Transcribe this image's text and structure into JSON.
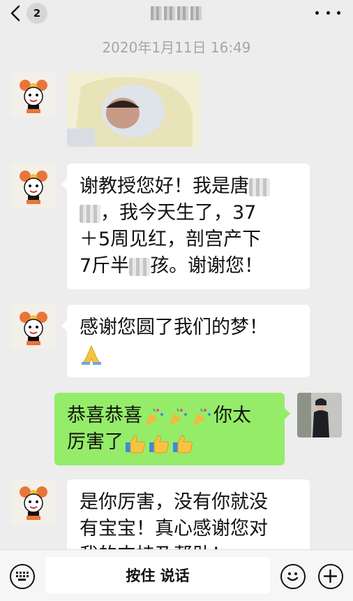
{
  "header": {
    "back_badge": "2",
    "title_redacted": true
  },
  "chat": {
    "timestamp": "2020年1月11日 16:49",
    "messages": [
      {
        "side": "left",
        "type": "image",
        "image_desc_icon": "newborn-photo"
      },
      {
        "side": "left",
        "type": "text",
        "lines": [
          "谢教授您好！我是唐",
          "，我今天生了，37",
          "＋5周见红，剖宫产下",
          "7斤半",
          "孩。谢谢您！"
        ]
      },
      {
        "side": "left",
        "type": "text",
        "lines": [
          "感谢您圆了我们的梦！"
        ],
        "emoji": "folded-hands-icon"
      },
      {
        "side": "right",
        "type": "text",
        "segments": [
          "恭喜恭喜",
          "你太",
          "厉害了"
        ]
      },
      {
        "side": "left",
        "type": "text",
        "lines": [
          "是你厉害，没有你就没",
          "有宝宝！真心感谢您对",
          "我的支持及帮助！"
        ]
      }
    ]
  },
  "input": {
    "voice_label": "按住 说话"
  },
  "colors": {
    "background": "#ededed",
    "green_bubble": "#95ec69",
    "white_bubble": "#ffffff"
  }
}
